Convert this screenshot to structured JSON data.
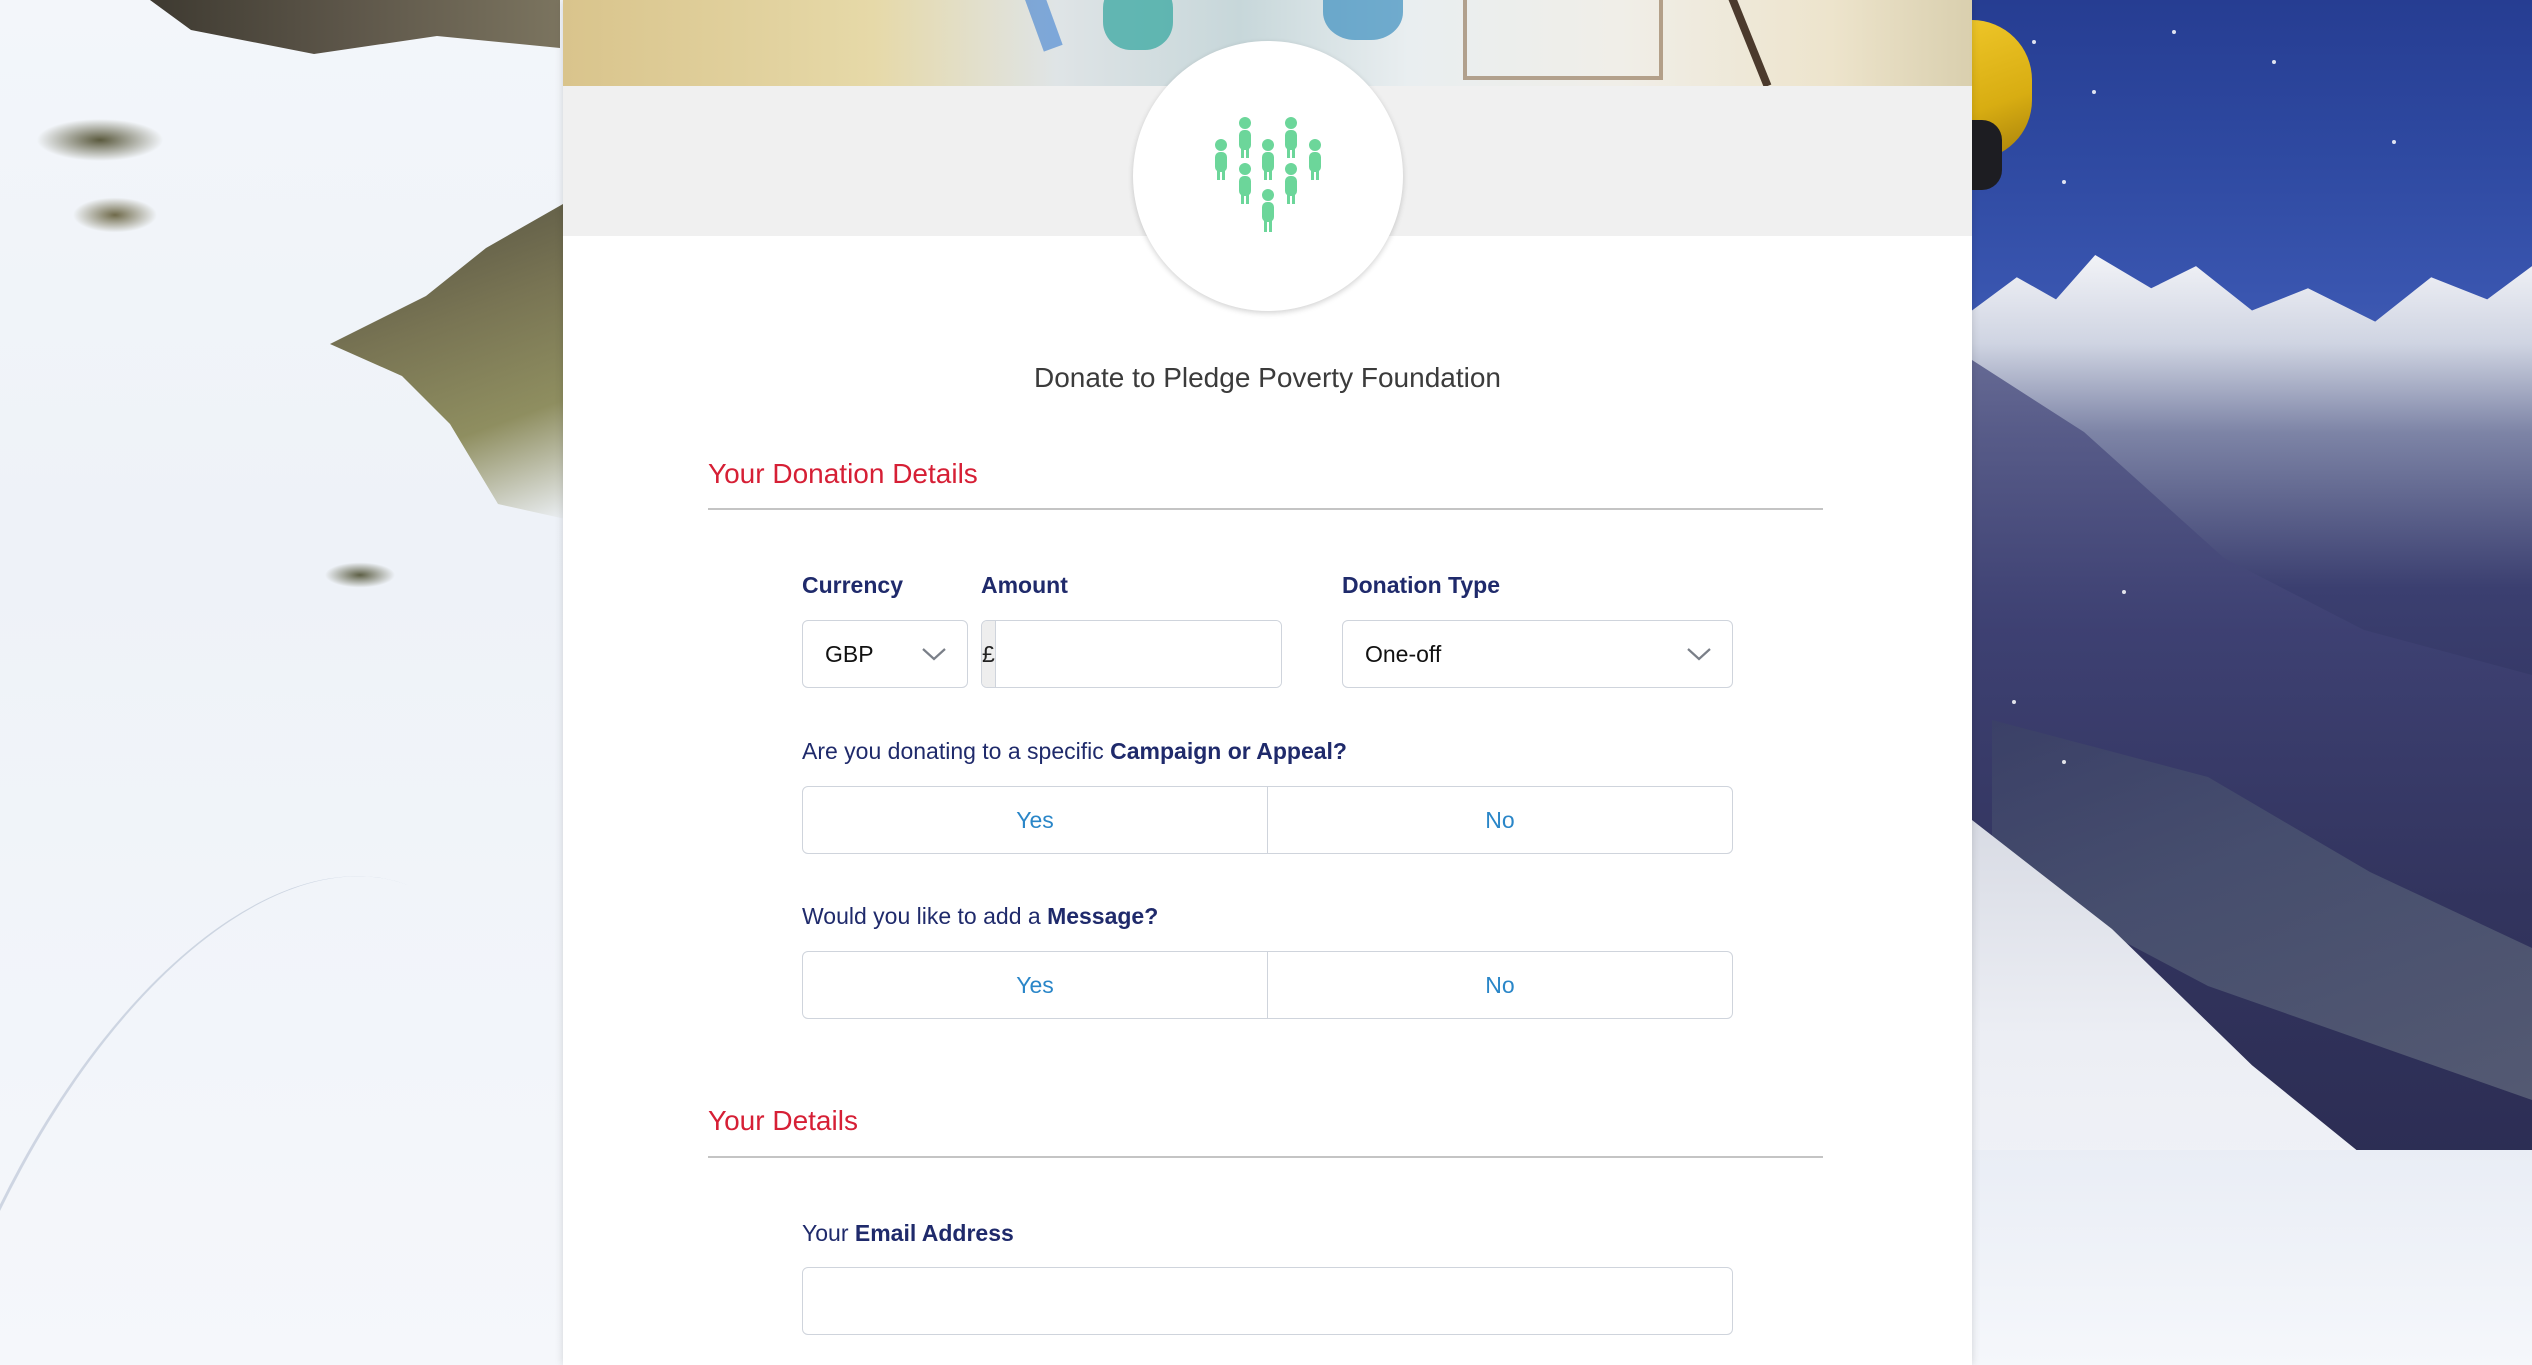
{
  "organization": {
    "title": "Donate to Pledge Poverty Foundation",
    "logo_icon": "people-heart-icon",
    "logo_color": "#6cd69a"
  },
  "colors": {
    "heading_red": "#d61f35",
    "label_navy": "#1f2a6b",
    "toggle_blue": "#2a86c8"
  },
  "donation_section": {
    "heading": "Your Donation Details",
    "currency": {
      "label": "Currency",
      "selected": "GBP"
    },
    "amount": {
      "label": "Amount",
      "prefix": "£",
      "value": ""
    },
    "donation_type": {
      "label": "Donation Type",
      "selected": "One-off"
    },
    "campaign_question": {
      "prefix": "Are you donating to a specific ",
      "emphasis": "Campaign or Appeal?",
      "yes": "Yes",
      "no": "No"
    },
    "message_question": {
      "prefix": "Would you like to add a ",
      "emphasis": "Message?",
      "yes": "Yes",
      "no": "No"
    }
  },
  "details_section": {
    "heading": "Your Details",
    "email": {
      "prefix": "Your ",
      "emphasis": "Email Address",
      "value": ""
    }
  }
}
